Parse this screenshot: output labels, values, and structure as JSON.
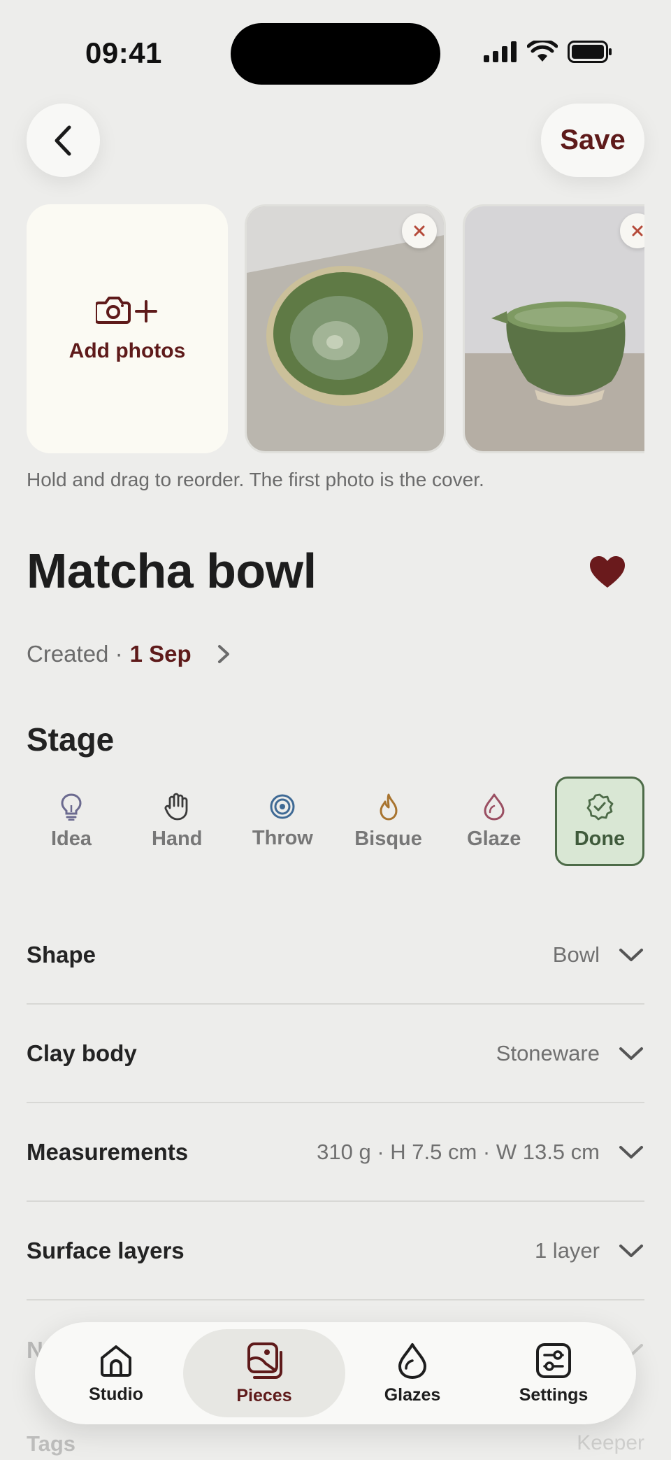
{
  "status": {
    "time": "09:41"
  },
  "header": {
    "save_label": "Save"
  },
  "photos": {
    "add_label": "Add photos",
    "hint": "Hold and drag to reorder. The first photo is the cover."
  },
  "piece": {
    "title": "Matcha bowl",
    "favorite": true,
    "created_label": "Created ·",
    "created_date": "1 Sep"
  },
  "stage": {
    "heading": "Stage",
    "items": [
      {
        "label": "Idea",
        "icon": "lightbulb-icon",
        "color": "#6b6a8f"
      },
      {
        "label": "Hand",
        "icon": "hand-icon",
        "color": "#3a3a3a"
      },
      {
        "label": "Throw",
        "icon": "target-icon",
        "color": "#3f6a95"
      },
      {
        "label": "Bisque",
        "icon": "flame-icon",
        "color": "#a8742f"
      },
      {
        "label": "Glaze",
        "icon": "drop-icon",
        "color": "#9a4f62"
      },
      {
        "label": "Done",
        "icon": "check-badge-icon",
        "color": "#4d6b48"
      }
    ],
    "selected": "Done"
  },
  "details": [
    {
      "label": "Shape",
      "value": "Bowl"
    },
    {
      "label": "Clay body",
      "value": "Stoneware"
    },
    {
      "label": "Measurements",
      "value": "310 g · H 7.5 cm · W 13.5 cm"
    },
    {
      "label": "Surface layers",
      "value": "1 layer"
    }
  ],
  "partial_row": {
    "label": "N"
  },
  "tags_row": {
    "label": "Tags",
    "value": "Keeper"
  },
  "tabbar": {
    "items": [
      {
        "label": "Studio",
        "icon": "house-icon"
      },
      {
        "label": "Pieces",
        "icon": "pieces-icon"
      },
      {
        "label": "Glazes",
        "icon": "drop-icon"
      },
      {
        "label": "Settings",
        "icon": "sliders-icon"
      }
    ],
    "active": "Pieces"
  },
  "colors": {
    "accent": "#5e1a1a",
    "done_bg": "#d9e7d4",
    "done_border": "#4d6b48",
    "background": "#ededeb"
  }
}
